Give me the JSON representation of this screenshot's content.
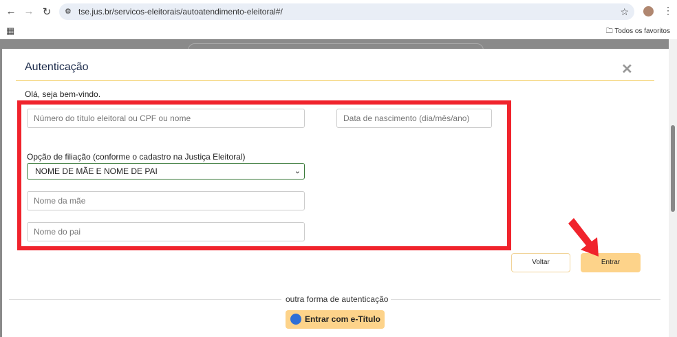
{
  "browser": {
    "url": "tse.jus.br/servicos-eleitorais/autoatendimento-eleitoral#/",
    "bookmarks_label": "Todos os favoritos"
  },
  "modal": {
    "title": "Autenticação",
    "welcome": "Olá, seja bem-vindo.",
    "fields": {
      "titulo_placeholder": "Número do título eleitoral ou CPF ou nome",
      "nascimento_placeholder": "Data de nascimento (dia/mês/ano)",
      "filiacao_label": "Opção de filiação (conforme o cadastro na Justiça Eleitoral)",
      "filiacao_value": "NOME DE MÃE E NOME DE PAI",
      "mae_placeholder": "Nome da mãe",
      "pai_placeholder": "Nome do pai"
    },
    "buttons": {
      "voltar": "Voltar",
      "entrar": "Entrar"
    },
    "other_auth": {
      "label": "outra forma de autenticação",
      "etitulo": "Entrar com e-Título"
    }
  },
  "colors": {
    "highlight": "#f0232c",
    "accent": "#fdd38a"
  }
}
